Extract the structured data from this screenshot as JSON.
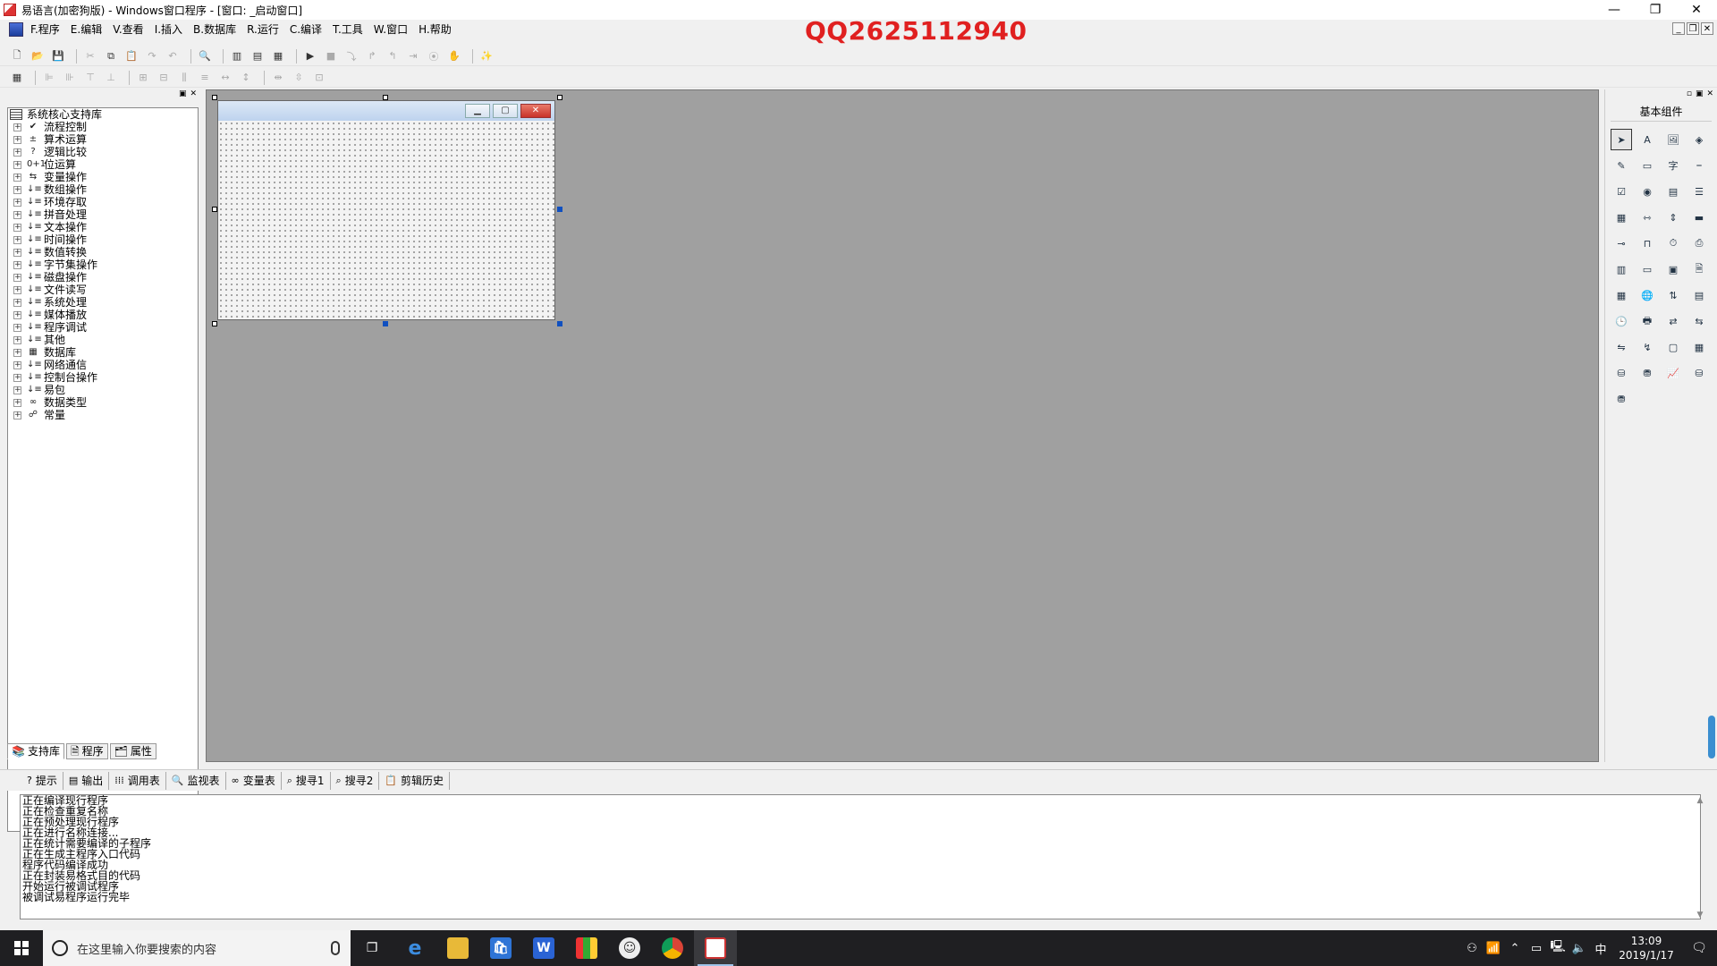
{
  "window": {
    "title": "易语言(加密狗版) - Windows窗口程序 - [窗口: _启动窗口]",
    "minimize": "—",
    "restore": "❐",
    "close": "✕"
  },
  "watermark": "QQ2625112940",
  "menu": [
    "F.程序",
    "E.编辑",
    "V.查看",
    "I.插入",
    "B.数据库",
    "R.运行",
    "C.编译",
    "T.工具",
    "W.窗口",
    "H.帮助"
  ],
  "mdi_controls": [
    "_",
    "❐",
    "✕"
  ],
  "left_panel": {
    "root": "系统核心支持库",
    "items": [
      {
        "label": "流程控制",
        "icon": "✔"
      },
      {
        "label": "算术运算",
        "icon": "±"
      },
      {
        "label": "逻辑比较",
        "icon": "?"
      },
      {
        "label": "位运算",
        "icon": "0+1"
      },
      {
        "label": "变量操作",
        "icon": "⇆"
      },
      {
        "label": "数组操作",
        "icon": "↓≡"
      },
      {
        "label": "环境存取",
        "icon": "↓≡"
      },
      {
        "label": "拼音处理",
        "icon": "↓≡"
      },
      {
        "label": "文本操作",
        "icon": "↓≡"
      },
      {
        "label": "时间操作",
        "icon": "↓≡"
      },
      {
        "label": "数值转换",
        "icon": "↓≡"
      },
      {
        "label": "字节集操作",
        "icon": "↓≡"
      },
      {
        "label": "磁盘操作",
        "icon": "↓≡"
      },
      {
        "label": "文件读写",
        "icon": "↓≡"
      },
      {
        "label": "系统处理",
        "icon": "↓≡"
      },
      {
        "label": "媒体播放",
        "icon": "↓≡"
      },
      {
        "label": "程序调试",
        "icon": "↓≡"
      },
      {
        "label": "其他",
        "icon": "↓≡"
      },
      {
        "label": "数据库",
        "icon": "▦"
      },
      {
        "label": "网络通信",
        "icon": "↓≡"
      },
      {
        "label": "控制台操作",
        "icon": "↓≡"
      },
      {
        "label": "易包",
        "icon": "↓≡"
      },
      {
        "label": "数据类型",
        "icon": "∞"
      },
      {
        "label": "常量",
        "icon": "☍"
      }
    ],
    "tabs": [
      "支持库",
      "程序",
      "属性"
    ]
  },
  "right_panel": {
    "title": "基本组件"
  },
  "bottom_tabs": [
    "提示",
    "输出",
    "调用表",
    "监视表",
    "变量表",
    "搜寻1",
    "搜寻2",
    "剪辑历史"
  ],
  "output_lines": [
    "正在编译现行程序",
    "正在检查重复名称",
    "正在预处理现行程序",
    "正在进行名称连接...",
    "正在统计需要编译的子程序",
    "正在生成主程序入口代码",
    "程序代码编译成功",
    "正在封装易格式目的代码",
    "开始运行被调试程序",
    "被调试易程序运行完毕"
  ],
  "taskbar": {
    "search_placeholder": "在这里输入你要搜索的内容",
    "ime": "中",
    "time": "13:09",
    "date": "2019/1/17"
  }
}
